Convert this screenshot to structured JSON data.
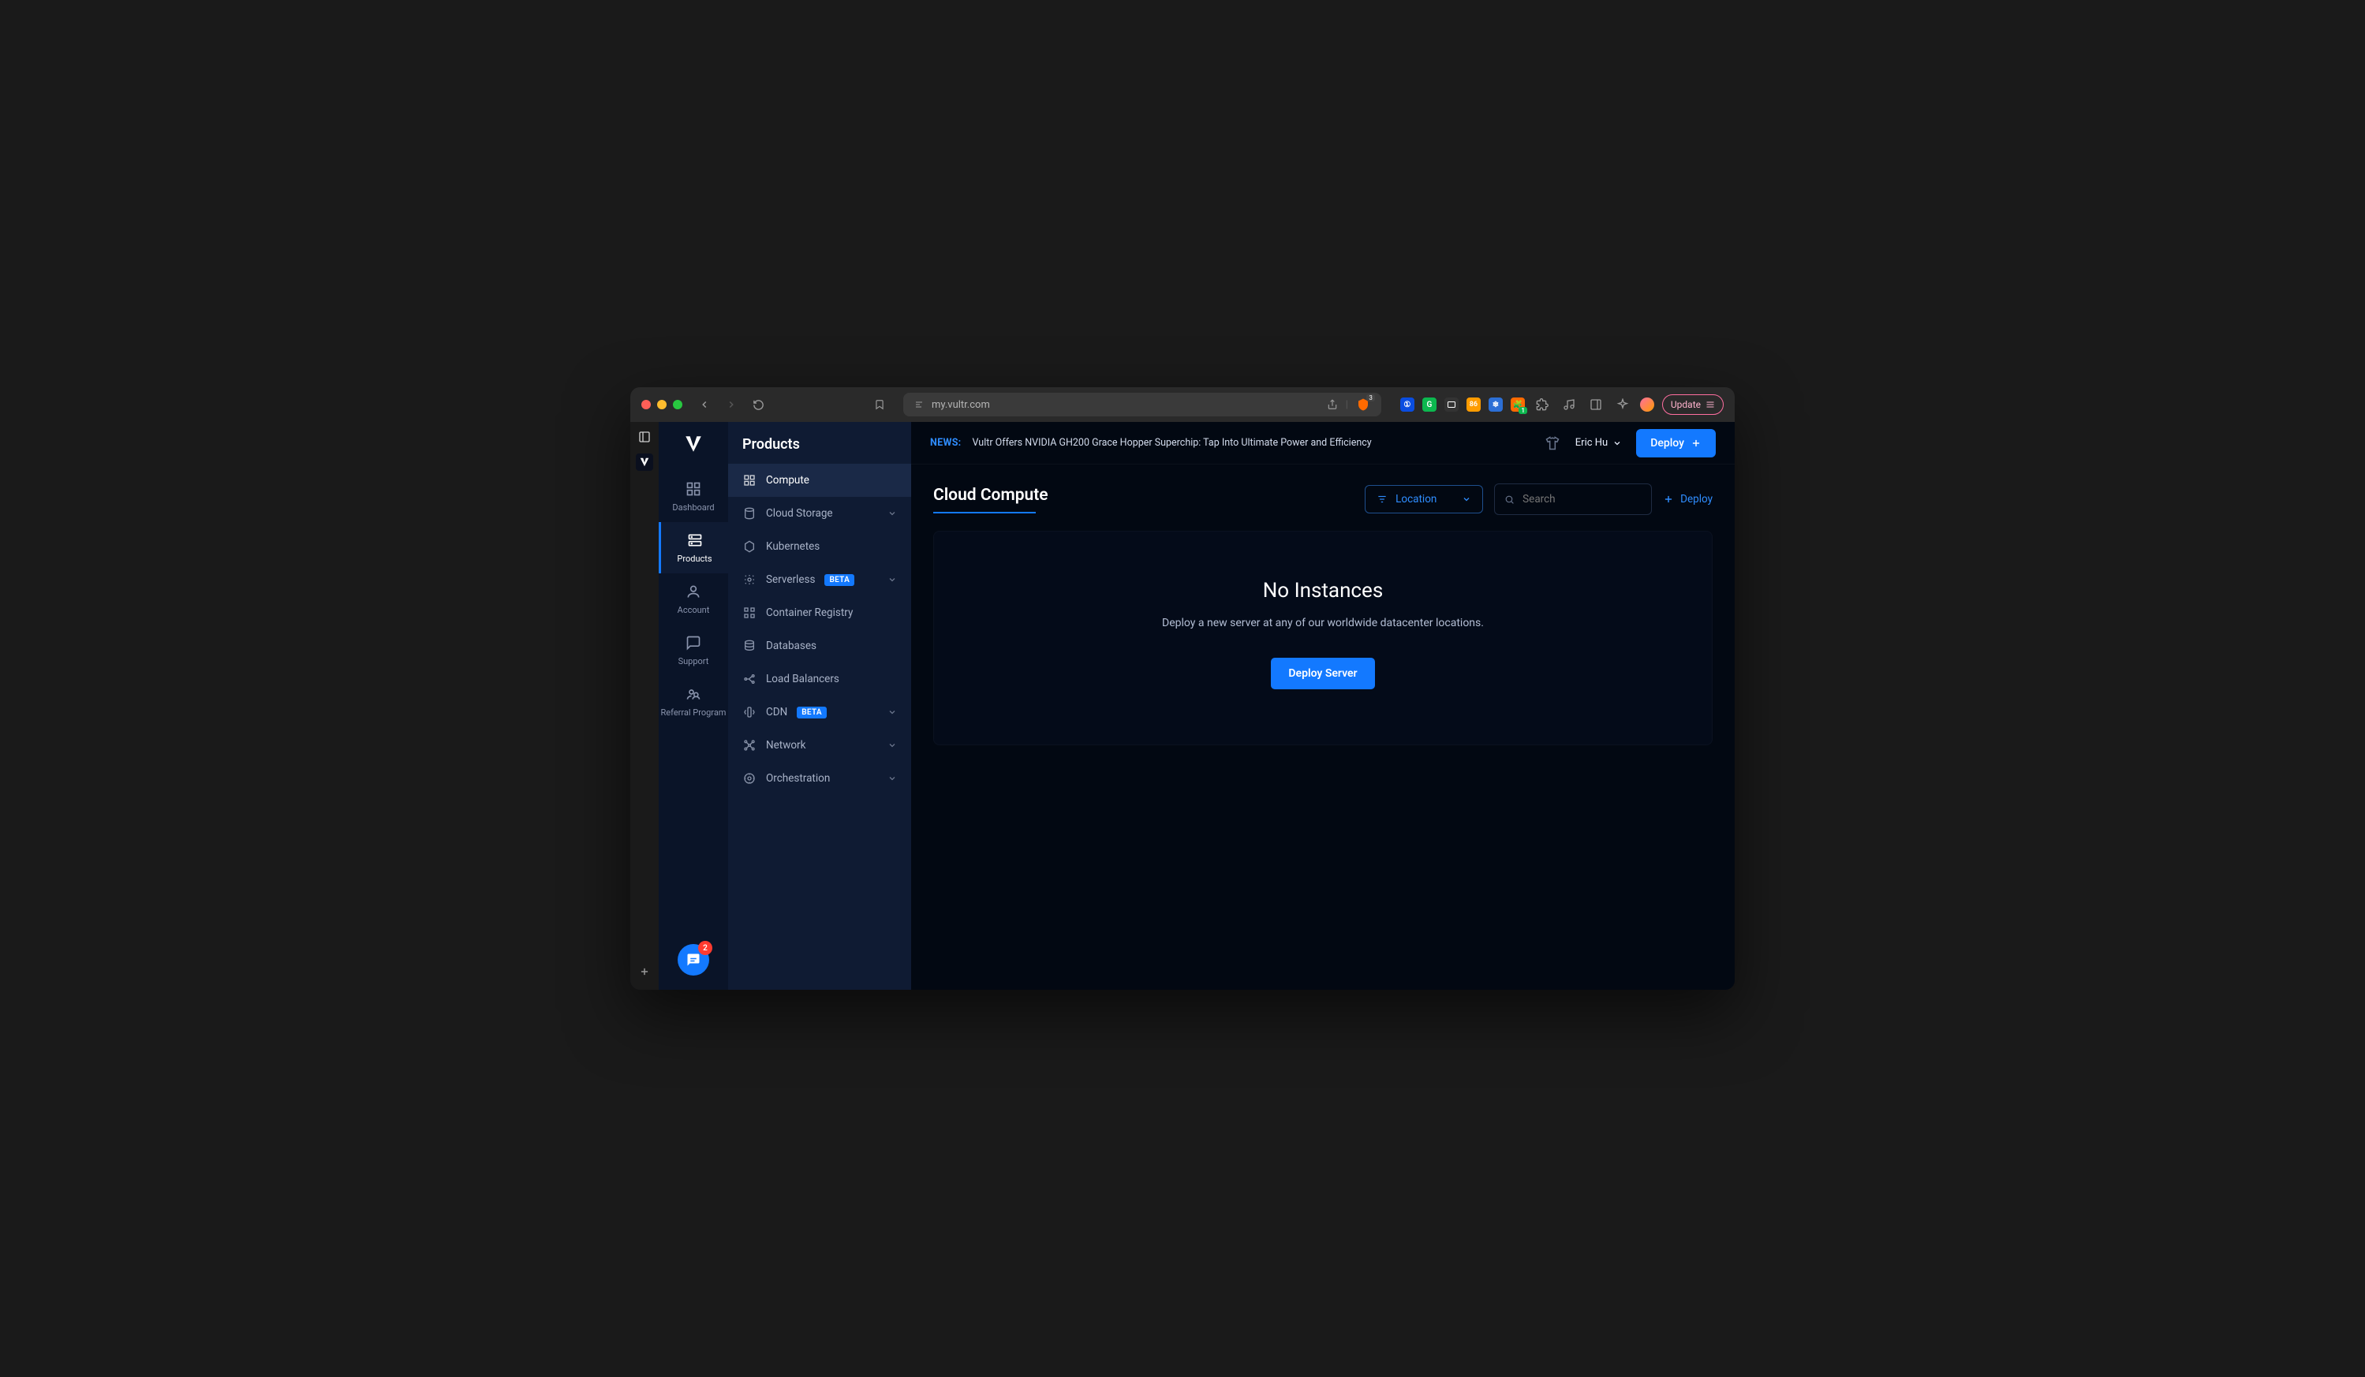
{
  "browser": {
    "url": "my.vultr.com",
    "update_label": "Update",
    "shield_badge": "3",
    "ext_badges": {
      "orange": "86",
      "green": "1"
    }
  },
  "topbar": {
    "news_label": "NEWS:",
    "news_text": "Vultr Offers NVIDIA GH200 Grace Hopper Superchip: Tap Into Ultimate Power and Efficiency",
    "user_name": "Eric Hu",
    "deploy_label": "Deploy"
  },
  "leftnav": {
    "title": "Products",
    "items": [
      {
        "label": "Dashboard"
      },
      {
        "label": "Products"
      },
      {
        "label": "Account"
      },
      {
        "label": "Support"
      },
      {
        "label": "Referral Program"
      }
    ],
    "chat_badge": "2"
  },
  "sidebar": {
    "items": [
      {
        "label": "Compute",
        "badge": null,
        "expand": false
      },
      {
        "label": "Cloud Storage",
        "badge": null,
        "expand": true
      },
      {
        "label": "Kubernetes",
        "badge": null,
        "expand": false
      },
      {
        "label": "Serverless",
        "badge": "BETA",
        "expand": true
      },
      {
        "label": "Container Registry",
        "badge": null,
        "expand": false
      },
      {
        "label": "Databases",
        "badge": null,
        "expand": false
      },
      {
        "label": "Load Balancers",
        "badge": null,
        "expand": false
      },
      {
        "label": "CDN",
        "badge": "BETA",
        "expand": true
      },
      {
        "label": "Network",
        "badge": null,
        "expand": true
      },
      {
        "label": "Orchestration",
        "badge": null,
        "expand": true
      }
    ]
  },
  "page": {
    "title": "Cloud Compute",
    "location_label": "Location",
    "search_placeholder": "Search",
    "deploy_link": "Deploy"
  },
  "empty": {
    "title": "No Instances",
    "subtitle": "Deploy a new server at any of our worldwide datacenter locations.",
    "button": "Deploy Server"
  }
}
